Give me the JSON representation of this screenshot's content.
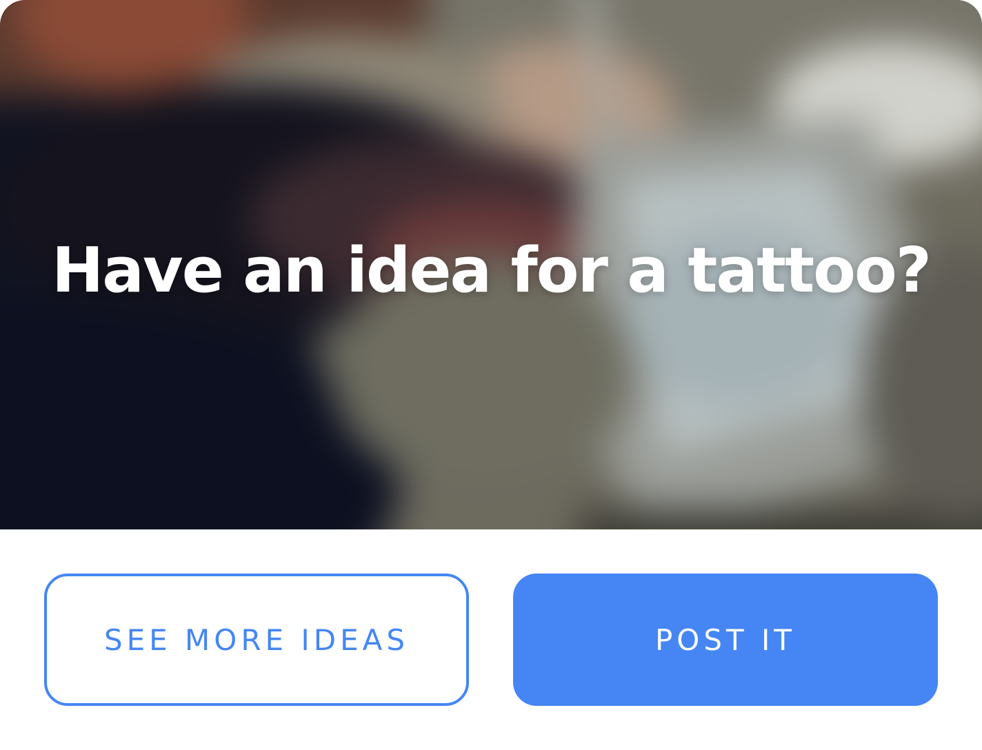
{
  "hero": {
    "title": "Have an idea for a tattoo?",
    "image_icon": "blurred-tattoo-sketch-photo"
  },
  "actions": {
    "secondary_label": "SEE MORE IDEAS",
    "primary_label": "POST IT"
  },
  "colors": {
    "accent": "#4586f4",
    "background": "#ffffff",
    "title_text": "#ffffff"
  }
}
